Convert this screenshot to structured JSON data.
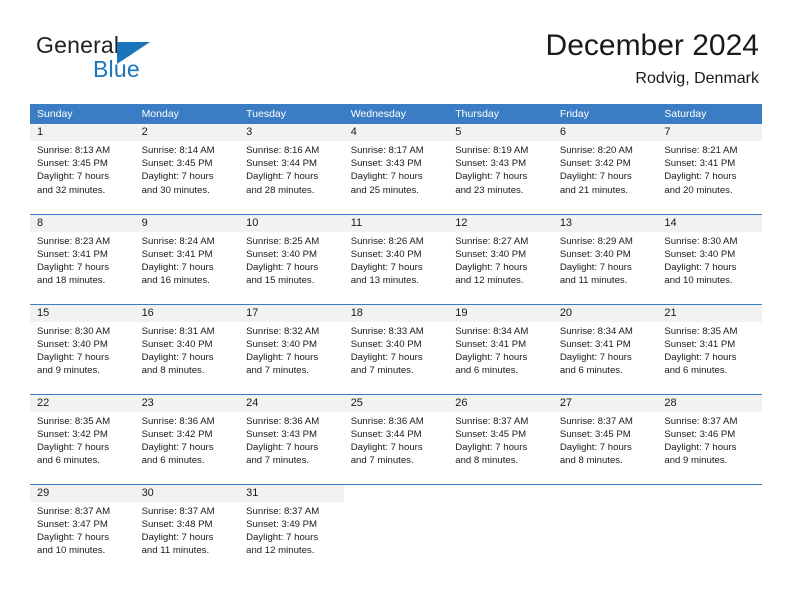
{
  "brand": {
    "name_part1": "General",
    "name_part2": "Blue",
    "triangle_color": "#1b75bb"
  },
  "header": {
    "title": "December 2024",
    "subtitle": "Rodvig, Denmark"
  },
  "theme": {
    "header_blue": "#3b7dc4",
    "daynum_band": "#f2f2f2",
    "text": "#1a1a1a"
  },
  "weekdays": [
    "Sunday",
    "Monday",
    "Tuesday",
    "Wednesday",
    "Thursday",
    "Friday",
    "Saturday"
  ],
  "weeks": [
    [
      {
        "day": "1",
        "sunrise": "Sunrise: 8:13 AM",
        "sunset": "Sunset: 3:45 PM",
        "daylight1": "Daylight: 7 hours",
        "daylight2": "and 32 minutes."
      },
      {
        "day": "2",
        "sunrise": "Sunrise: 8:14 AM",
        "sunset": "Sunset: 3:45 PM",
        "daylight1": "Daylight: 7 hours",
        "daylight2": "and 30 minutes."
      },
      {
        "day": "3",
        "sunrise": "Sunrise: 8:16 AM",
        "sunset": "Sunset: 3:44 PM",
        "daylight1": "Daylight: 7 hours",
        "daylight2": "and 28 minutes."
      },
      {
        "day": "4",
        "sunrise": "Sunrise: 8:17 AM",
        "sunset": "Sunset: 3:43 PM",
        "daylight1": "Daylight: 7 hours",
        "daylight2": "and 25 minutes."
      },
      {
        "day": "5",
        "sunrise": "Sunrise: 8:19 AM",
        "sunset": "Sunset: 3:43 PM",
        "daylight1": "Daylight: 7 hours",
        "daylight2": "and 23 minutes."
      },
      {
        "day": "6",
        "sunrise": "Sunrise: 8:20 AM",
        "sunset": "Sunset: 3:42 PM",
        "daylight1": "Daylight: 7 hours",
        "daylight2": "and 21 minutes."
      },
      {
        "day": "7",
        "sunrise": "Sunrise: 8:21 AM",
        "sunset": "Sunset: 3:41 PM",
        "daylight1": "Daylight: 7 hours",
        "daylight2": "and 20 minutes."
      }
    ],
    [
      {
        "day": "8",
        "sunrise": "Sunrise: 8:23 AM",
        "sunset": "Sunset: 3:41 PM",
        "daylight1": "Daylight: 7 hours",
        "daylight2": "and 18 minutes."
      },
      {
        "day": "9",
        "sunrise": "Sunrise: 8:24 AM",
        "sunset": "Sunset: 3:41 PM",
        "daylight1": "Daylight: 7 hours",
        "daylight2": "and 16 minutes."
      },
      {
        "day": "10",
        "sunrise": "Sunrise: 8:25 AM",
        "sunset": "Sunset: 3:40 PM",
        "daylight1": "Daylight: 7 hours",
        "daylight2": "and 15 minutes."
      },
      {
        "day": "11",
        "sunrise": "Sunrise: 8:26 AM",
        "sunset": "Sunset: 3:40 PM",
        "daylight1": "Daylight: 7 hours",
        "daylight2": "and 13 minutes."
      },
      {
        "day": "12",
        "sunrise": "Sunrise: 8:27 AM",
        "sunset": "Sunset: 3:40 PM",
        "daylight1": "Daylight: 7 hours",
        "daylight2": "and 12 minutes."
      },
      {
        "day": "13",
        "sunrise": "Sunrise: 8:29 AM",
        "sunset": "Sunset: 3:40 PM",
        "daylight1": "Daylight: 7 hours",
        "daylight2": "and 11 minutes."
      },
      {
        "day": "14",
        "sunrise": "Sunrise: 8:30 AM",
        "sunset": "Sunset: 3:40 PM",
        "daylight1": "Daylight: 7 hours",
        "daylight2": "and 10 minutes."
      }
    ],
    [
      {
        "day": "15",
        "sunrise": "Sunrise: 8:30 AM",
        "sunset": "Sunset: 3:40 PM",
        "daylight1": "Daylight: 7 hours",
        "daylight2": "and 9 minutes."
      },
      {
        "day": "16",
        "sunrise": "Sunrise: 8:31 AM",
        "sunset": "Sunset: 3:40 PM",
        "daylight1": "Daylight: 7 hours",
        "daylight2": "and 8 minutes."
      },
      {
        "day": "17",
        "sunrise": "Sunrise: 8:32 AM",
        "sunset": "Sunset: 3:40 PM",
        "daylight1": "Daylight: 7 hours",
        "daylight2": "and 7 minutes."
      },
      {
        "day": "18",
        "sunrise": "Sunrise: 8:33 AM",
        "sunset": "Sunset: 3:40 PM",
        "daylight1": "Daylight: 7 hours",
        "daylight2": "and 7 minutes."
      },
      {
        "day": "19",
        "sunrise": "Sunrise: 8:34 AM",
        "sunset": "Sunset: 3:41 PM",
        "daylight1": "Daylight: 7 hours",
        "daylight2": "and 6 minutes."
      },
      {
        "day": "20",
        "sunrise": "Sunrise: 8:34 AM",
        "sunset": "Sunset: 3:41 PM",
        "daylight1": "Daylight: 7 hours",
        "daylight2": "and 6 minutes."
      },
      {
        "day": "21",
        "sunrise": "Sunrise: 8:35 AM",
        "sunset": "Sunset: 3:41 PM",
        "daylight1": "Daylight: 7 hours",
        "daylight2": "and 6 minutes."
      }
    ],
    [
      {
        "day": "22",
        "sunrise": "Sunrise: 8:35 AM",
        "sunset": "Sunset: 3:42 PM",
        "daylight1": "Daylight: 7 hours",
        "daylight2": "and 6 minutes."
      },
      {
        "day": "23",
        "sunrise": "Sunrise: 8:36 AM",
        "sunset": "Sunset: 3:42 PM",
        "daylight1": "Daylight: 7 hours",
        "daylight2": "and 6 minutes."
      },
      {
        "day": "24",
        "sunrise": "Sunrise: 8:36 AM",
        "sunset": "Sunset: 3:43 PM",
        "daylight1": "Daylight: 7 hours",
        "daylight2": "and 7 minutes."
      },
      {
        "day": "25",
        "sunrise": "Sunrise: 8:36 AM",
        "sunset": "Sunset: 3:44 PM",
        "daylight1": "Daylight: 7 hours",
        "daylight2": "and 7 minutes."
      },
      {
        "day": "26",
        "sunrise": "Sunrise: 8:37 AM",
        "sunset": "Sunset: 3:45 PM",
        "daylight1": "Daylight: 7 hours",
        "daylight2": "and 8 minutes."
      },
      {
        "day": "27",
        "sunrise": "Sunrise: 8:37 AM",
        "sunset": "Sunset: 3:45 PM",
        "daylight1": "Daylight: 7 hours",
        "daylight2": "and 8 minutes."
      },
      {
        "day": "28",
        "sunrise": "Sunrise: 8:37 AM",
        "sunset": "Sunset: 3:46 PM",
        "daylight1": "Daylight: 7 hours",
        "daylight2": "and 9 minutes."
      }
    ],
    [
      {
        "day": "29",
        "sunrise": "Sunrise: 8:37 AM",
        "sunset": "Sunset: 3:47 PM",
        "daylight1": "Daylight: 7 hours",
        "daylight2": "and 10 minutes."
      },
      {
        "day": "30",
        "sunrise": "Sunrise: 8:37 AM",
        "sunset": "Sunset: 3:48 PM",
        "daylight1": "Daylight: 7 hours",
        "daylight2": "and 11 minutes."
      },
      {
        "day": "31",
        "sunrise": "Sunrise: 8:37 AM",
        "sunset": "Sunset: 3:49 PM",
        "daylight1": "Daylight: 7 hours",
        "daylight2": "and 12 minutes."
      },
      {
        "day": "",
        "sunrise": "",
        "sunset": "",
        "daylight1": "",
        "daylight2": ""
      },
      {
        "day": "",
        "sunrise": "",
        "sunset": "",
        "daylight1": "",
        "daylight2": ""
      },
      {
        "day": "",
        "sunrise": "",
        "sunset": "",
        "daylight1": "",
        "daylight2": ""
      },
      {
        "day": "",
        "sunrise": "",
        "sunset": "",
        "daylight1": "",
        "daylight2": ""
      }
    ]
  ]
}
